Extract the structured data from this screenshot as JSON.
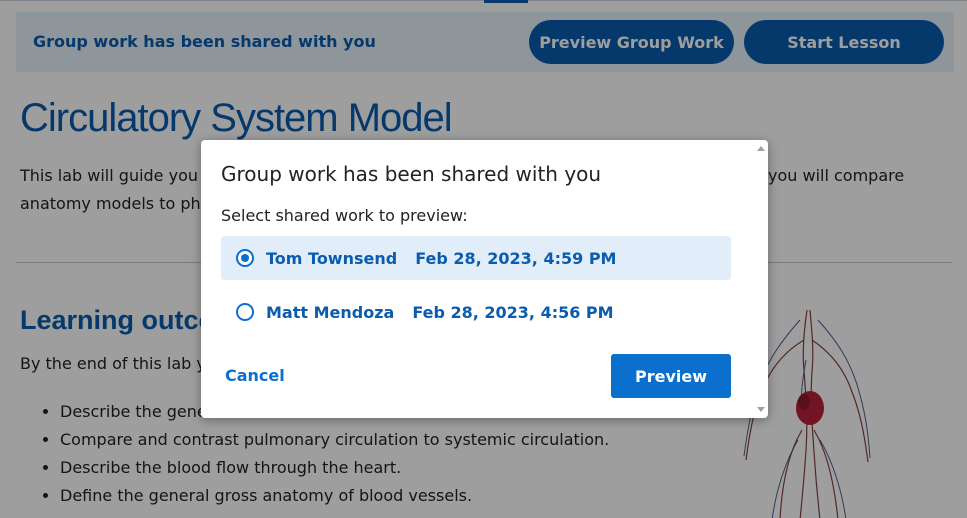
{
  "banner": {
    "text": "Group work has been shared with you",
    "preview_button": "Preview Group Work",
    "start_button": "Start Lesson"
  },
  "page": {
    "title": "Circulatory System Model",
    "intro_left": "This lab will guide you t",
    "intro_left2": "anatomy models to pho",
    "intro_right": "you will compare",
    "section_title": "Learning outco",
    "section_intro": "By the end of this lab y",
    "outcomes": [
      "Describe the gene",
      "Compare and contrast pulmonary circulation to systemic circulation.",
      "Describe the blood flow through the heart.",
      "Define the general gross anatomy of blood vessels."
    ]
  },
  "dialog": {
    "title": "Group work has been shared with you",
    "subtitle": "Select shared work to preview:",
    "options": [
      {
        "name": "Tom Townsend",
        "date": "Feb 28, 2023, 4:59 PM",
        "selected": true
      },
      {
        "name": "Matt Mendoza",
        "date": "Feb 28, 2023, 4:56 PM",
        "selected": false
      }
    ],
    "cancel": "Cancel",
    "preview": "Preview"
  },
  "colors": {
    "brand": "#0b5cad",
    "accent": "#0b6fce",
    "banner_bg": "#e6f0fa",
    "selected_bg": "#e1eef9"
  },
  "icons": {
    "anatomy": "circulatory-anatomy-figure"
  }
}
